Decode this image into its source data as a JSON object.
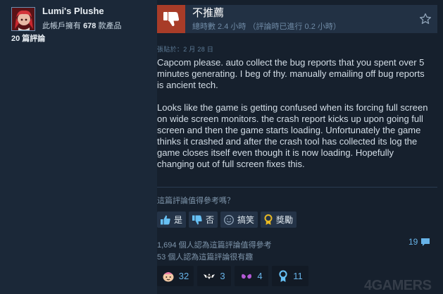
{
  "author": {
    "name": "Lumi's Plushe",
    "products_prefix": "此帳戶擁有",
    "products_count": "678",
    "products_suffix": "款產品",
    "reviews": "20 篇評論",
    "avatar_icon": "anime-avatar"
  },
  "review": {
    "verdict": "不推薦",
    "verdict_icon": "thumbs-down-icon",
    "hours": "總時數 2.4 小時 （評論時已進行 0.2 小時）",
    "posted": "張貼於：2 月 28 日",
    "paragraphs": [
      "Capcom please. auto collect the bug reports that you spent over 5 minutes generating. I beg of thy. manually emailing off bug reports is ancient tech.",
      "Looks like the game is getting confused when its forcing full screen on wide screen monitors. the crash report kicks up upon going full screen and then the game starts loading. Unfortunately the game thinks it crashed and after the crash tool has collected its log the game closes itself even though it is now loading. Hopefully changing out of full screen fixes this."
    ]
  },
  "helpful": {
    "question": "這篇評論值得參考嗎？",
    "yes_label": "是",
    "no_label": "否",
    "funny_label": "搞笑",
    "award_label": "獎勵",
    "yes_count_text": "1,694 個人認為這篇評論值得參考",
    "funny_count_text": "53 個人認為這篇評論很有趣"
  },
  "comments_count": "19",
  "awards": [
    {
      "icon": "smiling-face-award-icon",
      "count": "32"
    },
    {
      "icon": "deal-with-it-award-icon",
      "count": "3"
    },
    {
      "icon": "heart-eyes-award-icon",
      "count": "4"
    },
    {
      "icon": "medal-award-icon",
      "count": "11"
    }
  ],
  "watermark": "4GAMERS",
  "colors": {
    "background": "#1b2838",
    "panel": "#16202d",
    "not_recommended": "#a83c28",
    "link_blue": "#67b3e8"
  }
}
